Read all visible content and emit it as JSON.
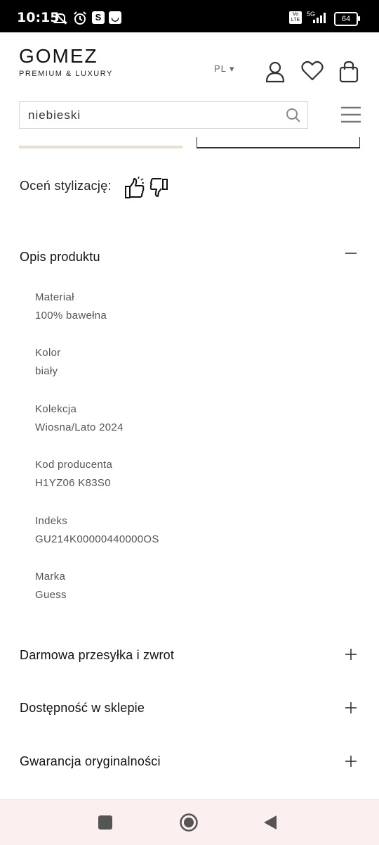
{
  "status_bar": {
    "time": "10:15",
    "battery": "64",
    "network": "5G",
    "volte": "Vo LTE"
  },
  "header": {
    "logo_name": "GOMEZ",
    "logo_tagline": "PREMIUM & LUXURY",
    "language": "PL",
    "icons": [
      "account-icon",
      "heart-icon",
      "bag-icon"
    ]
  },
  "search": {
    "value": "niebieski",
    "placeholder": ""
  },
  "rating": {
    "label": "Oceń stylizację:"
  },
  "description": {
    "title": "Opis produktu",
    "attributes": [
      {
        "label": "Materiał",
        "value": "100% bawełna"
      },
      {
        "label": "Kolor",
        "value": "biały"
      },
      {
        "label": "Kolekcja",
        "value": "Wiosna/Lato 2024"
      },
      {
        "label": "Kod producenta",
        "value": "H1YZ06 K83S0"
      },
      {
        "label": "Indeks",
        "value": "GU214K00000440000OS"
      },
      {
        "label": "Marka",
        "value": "Guess"
      }
    ]
  },
  "accordions": [
    {
      "title": "Darmowa przesyłka i zwrot"
    },
    {
      "title": "Dostępność w sklepie"
    },
    {
      "title": "Gwarancja oryginalności"
    }
  ],
  "colors": {
    "accent_bar": "#e6e0d0",
    "navbar_bg": "#fbf0ef"
  }
}
